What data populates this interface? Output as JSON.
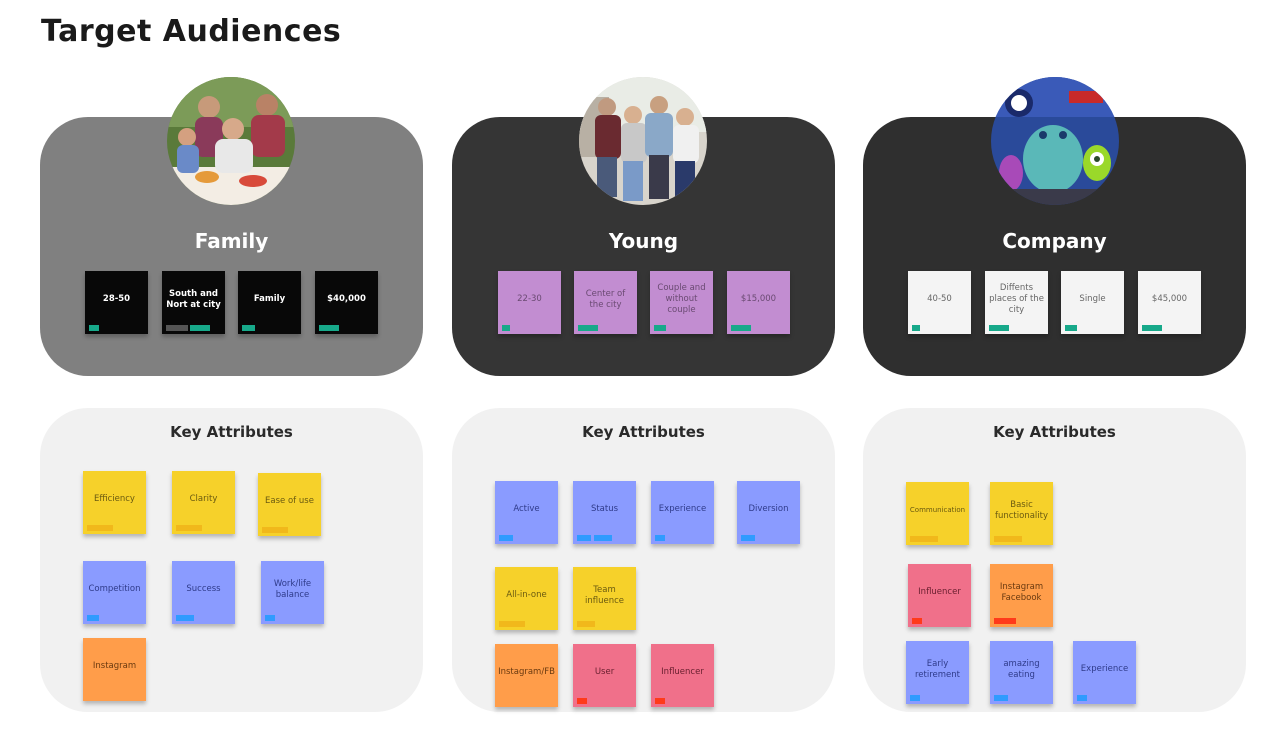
{
  "page": {
    "title": "Target Audiences"
  },
  "audiences": [
    {
      "name": "Family",
      "avatar_icon": "family-photo",
      "color": "#808080",
      "notes": [
        "28-50",
        "South and Nort at city",
        "Family",
        "$40,000"
      ],
      "key_attributes_title": "Key Attributes",
      "attributes": [
        "Efficiency",
        "Clarity",
        "Ease of use",
        "Competition",
        "Success",
        "Work/life balance",
        "Instagram"
      ]
    },
    {
      "name": "Young",
      "avatar_icon": "young-people-photo",
      "color": "#353535",
      "notes": [
        "22-30",
        "Center of the city",
        "Couple and without couple",
        "$15,000"
      ],
      "key_attributes_title": "Key Attributes",
      "attributes": [
        "Active",
        "Status",
        "Experience",
        "Diversion",
        "All-in-one",
        "Team influence",
        "Instagram/FB",
        "User",
        "Influencer"
      ]
    },
    {
      "name": "Company",
      "avatar_icon": "monsters-inc-photo",
      "color": "#2f2f2f",
      "notes": [
        "40-50",
        "Diffents places of the city",
        "Single",
        "$45,000"
      ],
      "key_attributes_title": "Key Attributes",
      "attributes": [
        "Communication",
        "Basic functionality",
        "Influencer",
        "Instagram Facebook",
        "Early retirement",
        "amazing eating",
        "Experience"
      ]
    }
  ],
  "colors": {
    "tag_green": "#17a98a",
    "tag_yellow": "#f1b81b",
    "tag_blue": "#2f9bff",
    "tag_red": "#ff3a1a",
    "tag_gray": "#555555"
  }
}
